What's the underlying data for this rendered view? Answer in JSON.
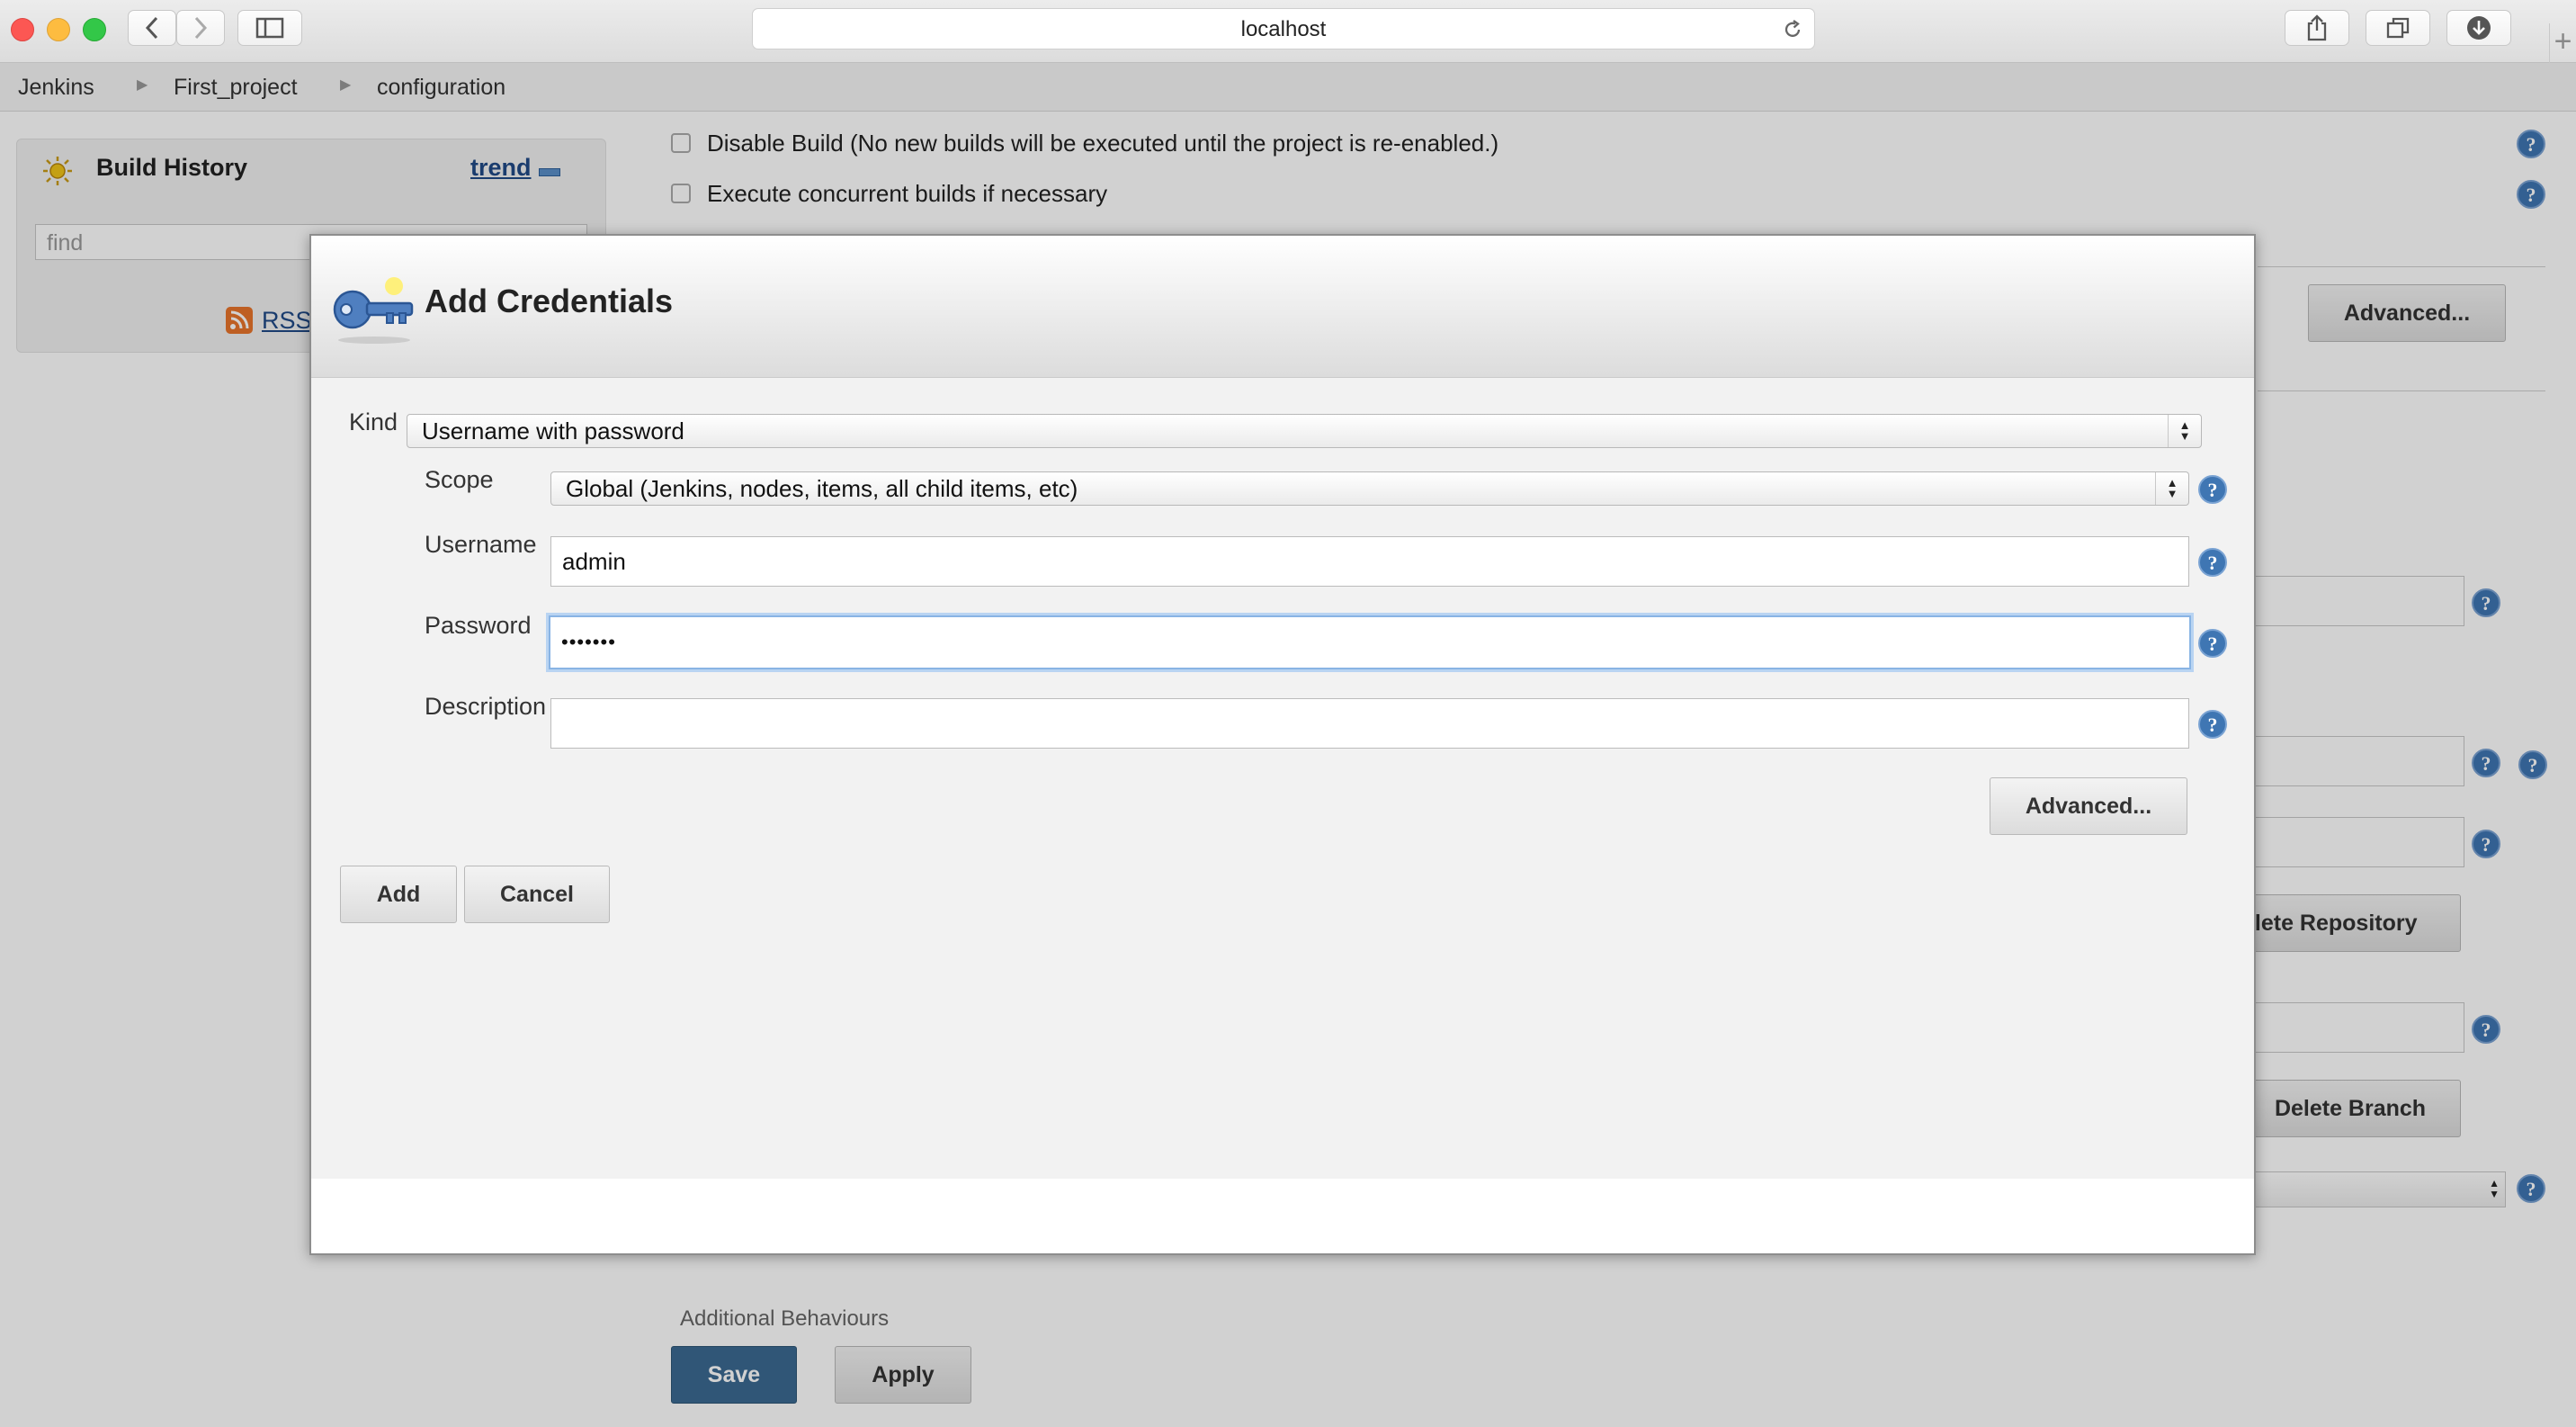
{
  "browser": {
    "url": "localhost"
  },
  "breadcrumb": [
    "Jenkins",
    "First_project",
    "configuration"
  ],
  "sidebar": {
    "title": "Build History",
    "trend_link": "trend",
    "search_placeholder": "find",
    "rss_label": "RSS"
  },
  "options": {
    "disable_build": "Disable Build (No new builds will be executed until the project is re-enabled.)",
    "concurrent": "Execute concurrent builds if necessary"
  },
  "background": {
    "advanced_label": "Advanced...",
    "delete_repository": "elete Repository",
    "delete_branch": "Delete Branch",
    "additional_behaviours": "Additional Behaviours",
    "save_label": "Save",
    "apply_label": "Apply"
  },
  "dialog": {
    "title": "Add Credentials",
    "kind_label": "Kind",
    "kind_value": "Username with password",
    "scope_label": "Scope",
    "scope_value": "Global (Jenkins, nodes, items, all child items, etc)",
    "username_label": "Username",
    "username_value": "admin",
    "password_label": "Password",
    "password_value": "•••••••",
    "description_label": "Description",
    "description_value": "",
    "advanced_label": "Advanced...",
    "add_label": "Add",
    "cancel_label": "Cancel"
  },
  "colors": {
    "help_blue": "#3f76b3",
    "save_blue": "#3b6a92",
    "link_blue": "#204a87"
  }
}
